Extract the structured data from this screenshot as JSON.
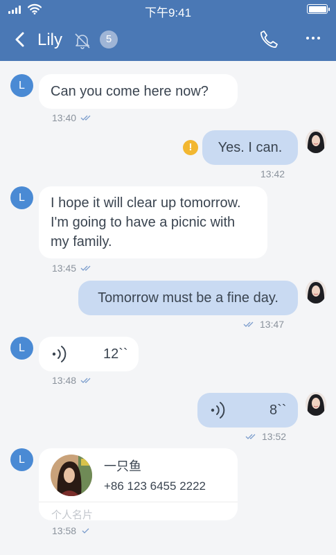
{
  "status_bar": {
    "time": "下午9:41"
  },
  "nav": {
    "title": "Lily",
    "unread_count": "5"
  },
  "contact_initial": "L",
  "messages": [
    {
      "dir": "in",
      "text": "Can you come here now?",
      "time": "13:40"
    },
    {
      "dir": "out",
      "text": "Yes. I can.",
      "time": "13:42",
      "error": "!"
    },
    {
      "dir": "in",
      "lines": [
        "I hope it will clear up tomorrow.",
        "I'm going to have a picnic with",
        "my family."
      ],
      "time": "13:45"
    },
    {
      "dir": "out",
      "text": "Tomorrow must be a fine day.",
      "time": "13:47"
    },
    {
      "dir": "in",
      "voice_duration": "12``",
      "time": "13:48"
    },
    {
      "dir": "out",
      "voice_duration": "8``",
      "time": "13:52"
    },
    {
      "dir": "in",
      "card_name": "一只鱼",
      "card_phone": "+86 123 6455 2222",
      "card_type": "个人名片",
      "time": "13:58"
    }
  ],
  "colors": {
    "header": "#4a78b5",
    "out_bubble": "#c9daf2",
    "avatar": "#4a8ad4",
    "warning": "#f2b731"
  }
}
